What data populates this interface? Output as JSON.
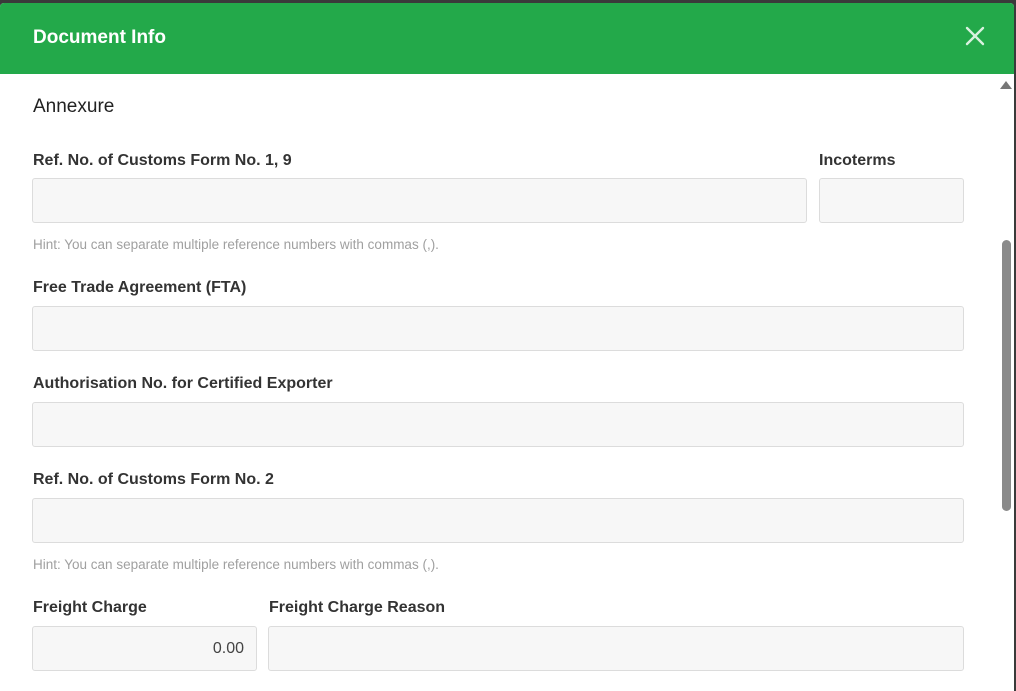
{
  "dialog": {
    "title": "Document Info",
    "header_color": "#23a94a",
    "close_icon": "close-icon"
  },
  "annexure": {
    "section_title": "Annexure",
    "customs_form_1_9": {
      "label": "Ref. No. of Customs Form No. 1, 9",
      "value": ""
    },
    "incoterms": {
      "label": "Incoterms",
      "value": ""
    },
    "hint_1": "Hint: You can separate multiple reference numbers with commas (,).",
    "fta": {
      "label": "Free Trade Agreement (FTA)",
      "value": ""
    },
    "certified_exporter": {
      "label": "Authorisation No. for Certified Exporter",
      "value": ""
    },
    "customs_form_2": {
      "label": "Ref. No. of Customs Form No. 2",
      "value": ""
    },
    "hint_2": "Hint: You can separate multiple reference numbers with commas (,).",
    "freight_charge": {
      "label": "Freight Charge",
      "value": "0.00"
    },
    "freight_charge_reason": {
      "label": "Freight Charge Reason",
      "value": ""
    }
  }
}
